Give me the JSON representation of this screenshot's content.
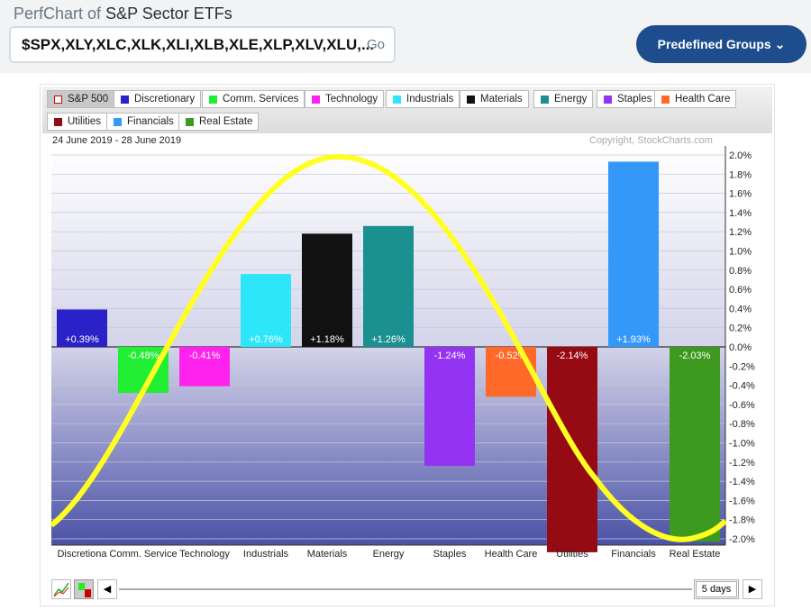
{
  "header": {
    "title_prefix": "PerfChart of",
    "title_name": "S&P Sector ETFs",
    "symbols": "$SPX,XLY,XLC,XLK,XLI,XLB,XLE,XLP,XLV,XLU,...",
    "go": "Go",
    "predefined": "Predefined Groups"
  },
  "legend": [
    {
      "label": "S&P 500",
      "color": "#ffffff"
    },
    {
      "label": "Discretionary",
      "color": "#2a22c8"
    },
    {
      "label": "Comm. Services",
      "color": "#22ee33"
    },
    {
      "label": "Technology",
      "color": "#ff22ee"
    },
    {
      "label": "Industrials",
      "color": "#2ee6fa"
    },
    {
      "label": "Materials",
      "color": "#111111"
    },
    {
      "label": "Energy",
      "color": "#1a9090"
    },
    {
      "label": "Staples",
      "color": "#9533f3"
    },
    {
      "label": "Health Care",
      "color": "#ff6a2a"
    },
    {
      "label": "Utilities",
      "color": "#960a14"
    },
    {
      "label": "Financials",
      "color": "#3498f8"
    },
    {
      "label": "Real Estate",
      "color": "#3e9a1e"
    }
  ],
  "date_range": "24 June 2019 - 28 June 2019",
  "copyright": "Copyright, StockCharts.com",
  "period": "5 days",
  "chart_data": {
    "type": "bar",
    "categories": [
      "Discretionary",
      "Comm. Services",
      "Technology",
      "Industrials",
      "Materials",
      "Energy",
      "Staples",
      "Health Care",
      "Utilities",
      "Financials",
      "Real Estate"
    ],
    "tick_labels": [
      "Discretiona",
      "Comm. Service",
      "Technology",
      "Industrials",
      "Materials",
      "Energy",
      "Staples",
      "Health Care",
      "Utilities",
      "Financials",
      "Real Estate"
    ],
    "values": [
      0.39,
      -0.48,
      -0.41,
      0.76,
      1.18,
      1.26,
      -1.24,
      -0.52,
      -2.14,
      1.93,
      -2.03
    ],
    "data_labels": [
      "+0.39%",
      "-0.48%",
      "-0.41%",
      "+0.76%",
      "+1.18%",
      "+1.26%",
      "-1.24%",
      "-0.52%",
      "-2.14%",
      "+1.93%",
      "-2.03%"
    ],
    "colors": [
      "#2a22c8",
      "#22ee33",
      "#ff22ee",
      "#2ee6fa",
      "#111111",
      "#1a9090",
      "#9533f3",
      "#ff6a2a",
      "#960a14",
      "#3498f8",
      "#3e9a1e"
    ],
    "ylim": [
      -2.1,
      2.0
    ],
    "yticks": [
      2.0,
      1.8,
      1.6,
      1.4,
      1.2,
      1.0,
      0.8,
      0.6,
      0.4,
      0.2,
      0.0,
      -0.2,
      -0.4,
      -0.6,
      -0.8,
      -1.0,
      -1.2,
      -1.4,
      -1.6,
      -1.8,
      -2.0
    ],
    "ytick_labels": [
      "2.0%",
      "1.8%",
      "1.6%",
      "1.4%",
      "1.2%",
      "1.0%",
      "0.8%",
      "0.6%",
      "0.4%",
      "0.2%",
      "0.0%",
      "-0.2%",
      "-0.4%",
      "-0.6%",
      "-0.8%",
      "-1.0%",
      "-1.2%",
      "-1.4%",
      "-1.6%",
      "-1.8%",
      "-2.0%"
    ],
    "annotation": "yellow sine-wave curve drawn over chart",
    "grid": true
  }
}
